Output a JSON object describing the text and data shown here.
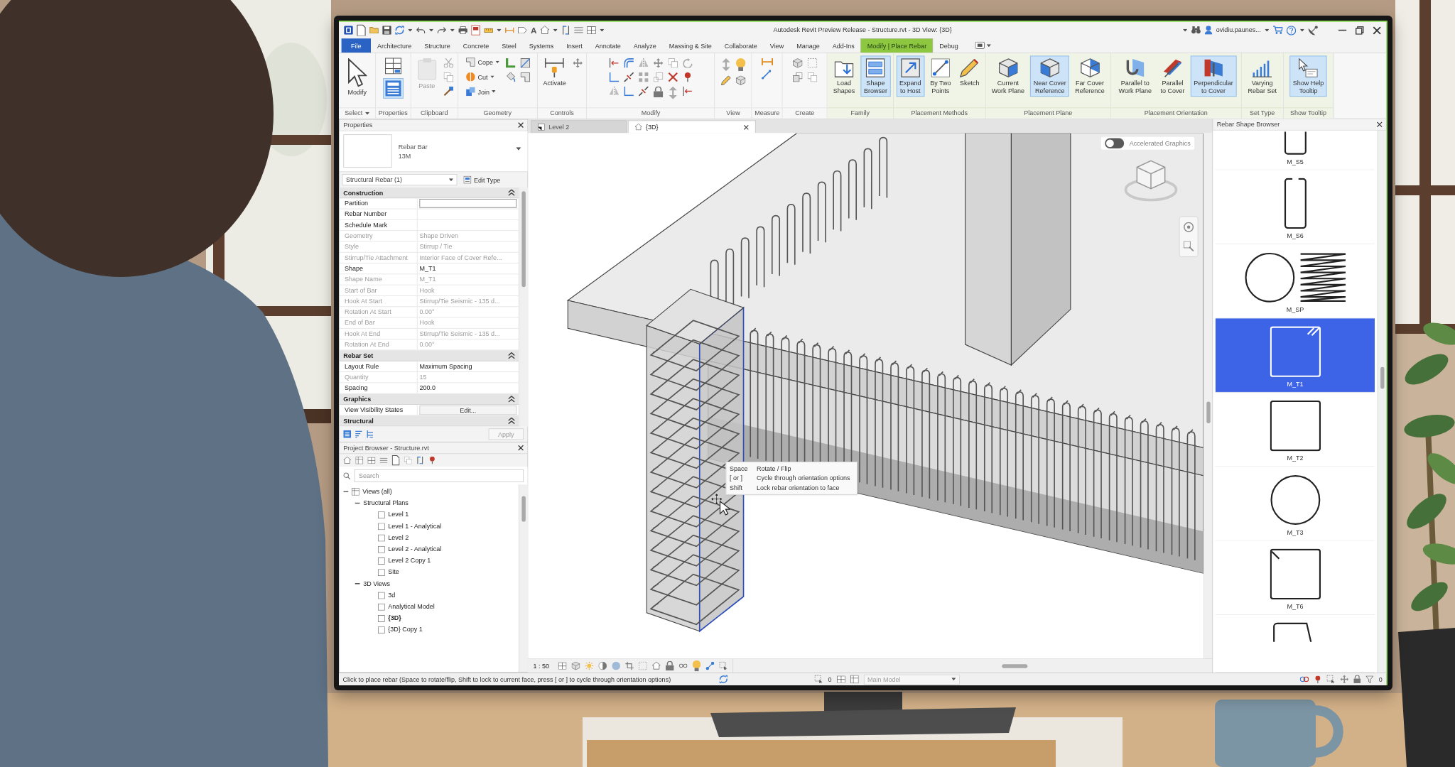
{
  "window": {
    "title": "Autodesk Revit Preview Release - Structure.rvt - 3D View: {3D}",
    "user": "ovidiu.paunes..."
  },
  "quick_access": {
    "text_tool": "A"
  },
  "ribbon_tabs": [
    {
      "label": "File",
      "kind": "file",
      "selected": false
    },
    {
      "label": "Architecture",
      "kind": "tab",
      "selected": false
    },
    {
      "label": "Structure",
      "kind": "tab",
      "selected": false
    },
    {
      "label": "Concrete",
      "kind": "tab",
      "selected": false
    },
    {
      "label": "Steel",
      "kind": "tab",
      "selected": false
    },
    {
      "label": "Systems",
      "kind": "tab",
      "selected": false
    },
    {
      "label": "Insert",
      "kind": "tab",
      "selected": false
    },
    {
      "label": "Annotate",
      "kind": "tab",
      "selected": false
    },
    {
      "label": "Analyze",
      "kind": "tab",
      "selected": false
    },
    {
      "label": "Massing & Site",
      "kind": "tab",
      "selected": false
    },
    {
      "label": "Collaborate",
      "kind": "tab",
      "selected": false
    },
    {
      "label": "View",
      "kind": "tab",
      "selected": false
    },
    {
      "label": "Manage",
      "kind": "tab",
      "selected": false
    },
    {
      "label": "Add-Ins",
      "kind": "tab",
      "selected": false
    },
    {
      "label": "Modify | Place Rebar",
      "kind": "contextual",
      "selected": true
    },
    {
      "label": "Debug",
      "kind": "tab",
      "selected": false
    }
  ],
  "ribbon_panels": [
    {
      "label": "Select",
      "kind": "standard",
      "dropdown": true,
      "buttons": [
        {
          "label": "Modify",
          "kind": "large",
          "selected": false,
          "disabled": false
        }
      ]
    },
    {
      "label": "Properties",
      "kind": "standard",
      "dropdown": false,
      "buttons": [
        {
          "kind": "icon",
          "selected": false,
          "disabled": false
        },
        {
          "kind": "icon",
          "selected": true,
          "disabled": false
        }
      ]
    },
    {
      "label": "Clipboard",
      "kind": "standard",
      "dropdown": false,
      "buttons": [
        {
          "label": "Paste",
          "kind": "large",
          "selected": false,
          "disabled": true
        }
      ]
    },
    {
      "label": "Geometry",
      "kind": "standard",
      "dropdown": false,
      "buttons": [
        {
          "label": "Cope",
          "kind": "menu",
          "selected": false,
          "disabled": false
        },
        {
          "label": "Cut",
          "kind": "menu",
          "selected": false,
          "disabled": false
        },
        {
          "label": "Join",
          "kind": "menu",
          "selected": false,
          "disabled": false
        }
      ]
    },
    {
      "label": "Controls",
      "kind": "standard",
      "dropdown": false,
      "buttons": [
        {
          "label": "Activate",
          "kind": "large",
          "selected": false,
          "disabled": false
        }
      ]
    },
    {
      "label": "Modify",
      "kind": "standard",
      "dropdown": false
    },
    {
      "label": "View",
      "kind": "standard",
      "dropdown": false
    },
    {
      "label": "Measure",
      "kind": "standard",
      "dropdown": false
    },
    {
      "label": "Create",
      "kind": "standard",
      "dropdown": false
    },
    {
      "label": "Family",
      "kind": "contextual",
      "dropdown": false,
      "buttons": [
        {
          "label": "Load\nShapes",
          "kind": "large",
          "selected": false,
          "disabled": false
        },
        {
          "label": "Shape\nBrowser",
          "kind": "large",
          "selected": true,
          "disabled": false
        }
      ]
    },
    {
      "label": "Placement Methods",
      "kind": "contextual",
      "dropdown": false,
      "buttons": [
        {
          "label": "Expand\nto Host",
          "kind": "large",
          "selected": true,
          "disabled": false
        },
        {
          "label": "By Two\nPoints",
          "kind": "large",
          "selected": false,
          "disabled": false
        },
        {
          "label": "Sketch",
          "kind": "large",
          "selected": false,
          "disabled": false
        }
      ]
    },
    {
      "label": "Placement Plane",
      "kind": "contextual",
      "dropdown": false,
      "buttons": [
        {
          "label": "Current\nWork Plane",
          "kind": "large",
          "selected": false,
          "disabled": false
        },
        {
          "label": "Near Cover\nReference",
          "kind": "large",
          "selected": true,
          "disabled": false
        },
        {
          "label": "Far Cover\nReference",
          "kind": "large",
          "selected": false,
          "disabled": false
        }
      ]
    },
    {
      "label": "Placement Orientation",
      "kind": "contextual",
      "dropdown": false,
      "buttons": [
        {
          "label": "Parallel to\nWork Plane",
          "kind": "large",
          "selected": false,
          "disabled": false
        },
        {
          "label": "Parallel\nto Cover",
          "kind": "large",
          "selected": false,
          "disabled": false
        },
        {
          "label": "Perpendicular\nto Cover",
          "kind": "large",
          "selected": true,
          "disabled": false
        }
      ]
    },
    {
      "label": "Set Type",
      "kind": "contextual",
      "dropdown": false,
      "buttons": [
        {
          "label": "Varying\nRebar Set",
          "kind": "large",
          "selected": false,
          "disabled": false
        }
      ]
    },
    {
      "label": "Show Tooltip",
      "kind": "contextual",
      "dropdown": false,
      "buttons": [
        {
          "label": "Show Help\nTooltip",
          "kind": "large",
          "selected": true,
          "disabled": false
        }
      ]
    }
  ],
  "properties": {
    "title": "Properties",
    "type_name": "Rebar Bar",
    "type_size": "13M",
    "instance_filter": "Structural Rebar (1)",
    "edit_type": "Edit Type",
    "groups": [
      {
        "name": "Construction",
        "expanded": true,
        "rows": [
          {
            "label": "Partition",
            "kind": "input",
            "disabled": false
          },
          {
            "label": "Rebar Number",
            "kind": "text",
            "disabled": false
          },
          {
            "label": "Schedule Mark",
            "kind": "text",
            "disabled": false
          },
          {
            "label": "Geometry",
            "value": "Shape Driven",
            "kind": "text",
            "disabled": true
          },
          {
            "label": "Style",
            "value": "Stirrup / Tie",
            "kind": "text",
            "disabled": true
          },
          {
            "label": "Stirrup/Tie Attachment",
            "value": "Interior Face of Cover Refe...",
            "kind": "text",
            "disabled": true
          },
          {
            "label": "Shape",
            "value": "M_T1",
            "kind": "text",
            "disabled": false
          },
          {
            "label": "Shape Name",
            "value": "M_T1",
            "kind": "text",
            "disabled": true
          },
          {
            "label": "Start of Bar",
            "value": "Hook",
            "kind": "text",
            "disabled": true
          },
          {
            "label": "Hook At Start",
            "value": "Stirrup/Tie Seismic - 135 d...",
            "kind": "text",
            "disabled": true
          },
          {
            "label": "Rotation At Start",
            "value": "0.00°",
            "kind": "text",
            "disabled": true
          },
          {
            "label": "End of Bar",
            "value": "Hook",
            "kind": "text",
            "disabled": true
          },
          {
            "label": "Hook At End",
            "value": "Stirrup/Tie Seismic - 135 d...",
            "kind": "text",
            "disabled": true
          },
          {
            "label": "Rotation At End",
            "value": "0.00°",
            "kind": "text",
            "disabled": true
          }
        ]
      },
      {
        "name": "Rebar Set",
        "expanded": true,
        "rows": [
          {
            "label": "Layout Rule",
            "value": "Maximum Spacing",
            "kind": "text",
            "disabled": false
          },
          {
            "label": "Quantity",
            "value": "15",
            "kind": "text",
            "disabled": true
          },
          {
            "label": "Spacing",
            "value": "200.0",
            "kind": "text",
            "disabled": false
          }
        ]
      },
      {
        "name": "Graphics",
        "expanded": true,
        "rows": [
          {
            "label": "View Visibility States",
            "value": "Edit...",
            "kind": "button",
            "disabled": false
          }
        ]
      },
      {
        "name": "Structural",
        "expanded": true
      }
    ],
    "apply": {
      "label": "Apply",
      "disabled": true
    }
  },
  "project_browser": {
    "title": "Project Browser - Structure.rvt",
    "search": {
      "placeholder": "Search"
    },
    "tree": [
      {
        "label": "Views (all)",
        "expanded": true,
        "children": [
          {
            "label": "Structural Plans",
            "expanded": true,
            "children": [
              {
                "label": "Level 1",
                "current": false
              },
              {
                "label": "Level 1 - Analytical",
                "current": false
              },
              {
                "label": "Level 2",
                "current": false
              },
              {
                "label": "Level 2 - Analytical",
                "current": false
              },
              {
                "label": "Level 2 Copy 1",
                "current": false
              },
              {
                "label": "Site",
                "current": false
              }
            ]
          },
          {
            "label": "3D Views",
            "expanded": true,
            "children": [
              {
                "label": "3d",
                "current": false
              },
              {
                "label": "Analytical Model",
                "current": false
              },
              {
                "label": "{3D}",
                "current": true
              },
              {
                "label": "{3D} Copy 1",
                "current": false
              }
            ]
          }
        ]
      }
    ]
  },
  "view_tabs": [
    {
      "label": "Level 2",
      "selected": false
    },
    {
      "label": "{3D}",
      "selected": true
    }
  ],
  "viewport": {
    "accelerated_graphics": {
      "label": "Accelerated Graphics",
      "on": false
    },
    "tooltip": [
      {
        "key": "Space",
        "action": "Rotate / Flip"
      },
      {
        "key": "[ or ]",
        "action": "Cycle through orientation options"
      },
      {
        "key": "Shift",
        "action": "Lock rebar orientation to face"
      }
    ],
    "scale": "1 : 50"
  },
  "shape_browser": {
    "title": "Rebar Shape Browser",
    "shapes": [
      {
        "name": "M_S5",
        "kind": "closed_stirrup",
        "selected": false
      },
      {
        "name": "M_S6",
        "kind": "open_stirrup",
        "selected": false
      },
      {
        "name": "M_SP",
        "kind": "spiral",
        "selected": false
      },
      {
        "name": "M_T1",
        "kind": "hooked_tie",
        "selected": true
      },
      {
        "name": "M_T2",
        "kind": "tie",
        "selected": false
      },
      {
        "name": "M_T3",
        "kind": "circular_tie",
        "selected": false
      },
      {
        "name": "M_T6",
        "kind": "corner_hook_tie",
        "selected": false
      },
      {
        "kind": "bent_bar",
        "selected": false
      }
    ]
  },
  "status_bar": {
    "message": "Click to place rebar (Space to rotate/flip, Shift to lock to current face, press [ or ] to cycle through orientation options)",
    "counter": "0",
    "model": {
      "label": "Main Model",
      "disabled": true
    },
    "filter_count": "0"
  }
}
